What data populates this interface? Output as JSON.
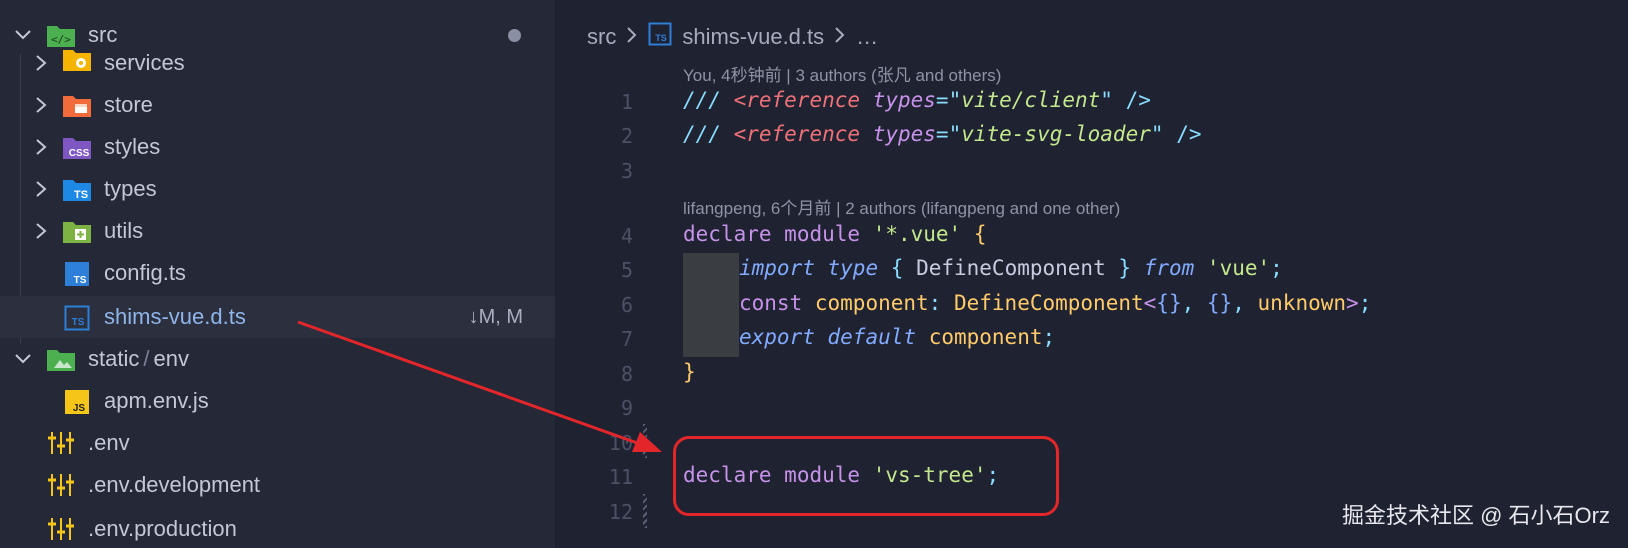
{
  "sidebar": {
    "root": {
      "label": "src",
      "icon": "folder-src-icon"
    },
    "items": [
      {
        "label": "services",
        "icon": "folder-services-icon",
        "type": "folder"
      },
      {
        "label": "store",
        "icon": "folder-store-icon",
        "type": "folder"
      },
      {
        "label": "styles",
        "icon": "folder-css-icon",
        "type": "folder",
        "icon_text": "CSS"
      },
      {
        "label": "types",
        "icon": "folder-ts-icon",
        "type": "folder",
        "icon_text": "TS"
      },
      {
        "label": "utils",
        "icon": "folder-utils-icon",
        "type": "folder"
      },
      {
        "label": "config.ts",
        "icon": "ts-file-icon",
        "type": "file",
        "icon_text": "TS"
      },
      {
        "label": "shims-vue.d.ts",
        "icon": "ts-file-icon",
        "type": "file",
        "icon_text": "TS",
        "badge": "↓M, M"
      }
    ],
    "static_env": {
      "label1": "static",
      "sep": "/",
      "label2": "env"
    },
    "static_items": [
      {
        "label": "apm.env.js",
        "icon": "js-file-icon",
        "icon_text": "JS"
      }
    ],
    "env_files": [
      {
        "label": ".env"
      },
      {
        "label": ".env.development"
      },
      {
        "label": ".env.production"
      }
    ]
  },
  "editor": {
    "breadcrumb": {
      "folder": "src",
      "file": "shims-vue.d.ts",
      "more": "…",
      "file_icon_text": "TS"
    },
    "blame": [
      "You, 4秒钟前 | 3 authors (张凡 and others)",
      "lifangpeng, 6个月前 | 2 authors (lifangpeng and one other)"
    ],
    "line_numbers": [
      "1",
      "2",
      "3",
      "4",
      "5",
      "6",
      "7",
      "8",
      "9",
      "10",
      "11",
      "12"
    ],
    "lines": {
      "l1": {
        "c": "///",
        "tag": "<reference",
        "attr": "types",
        "eq": "=",
        "q1": "\"",
        "val": "vite/client",
        "q2": "\"",
        "end": "/>"
      },
      "l2": {
        "c": "///",
        "tag": "<reference",
        "attr": "types",
        "eq": "=",
        "q1": "\"",
        "val": "vite-svg-loader",
        "q2": "\"",
        "end": "/>"
      },
      "l4": {
        "kw1": "declare",
        "kw2": "module",
        "str": "'*.vue'",
        "br": "{"
      },
      "l5": {
        "kw": "import",
        "kw2": "type",
        "b1": "{",
        "name": "DefineComponent",
        "b2": "}",
        "from": "from",
        "str": "'vue'",
        "semi": ";"
      },
      "l6": {
        "kw": "const",
        "name": "component",
        "colon": ":",
        "type": "DefineComponent",
        "lt": "<",
        "o1": "{}",
        "comma1": ",",
        "o2": "{}",
        "comma2": ",",
        "unk": "unknown",
        "gt": ">",
        "semi": ";"
      },
      "l7": {
        "kw": "export",
        "kw2": "default",
        "name": "component",
        "semi": ";"
      },
      "l8": {
        "br": "}"
      },
      "l11": {
        "kw1": "declare",
        "kw2": "module",
        "str": "'vs-tree'",
        "semi": ";"
      }
    }
  },
  "watermark": "掘金技术社区 @ 石小石Orz",
  "colors": {
    "annotation_red": "#e3262a"
  }
}
